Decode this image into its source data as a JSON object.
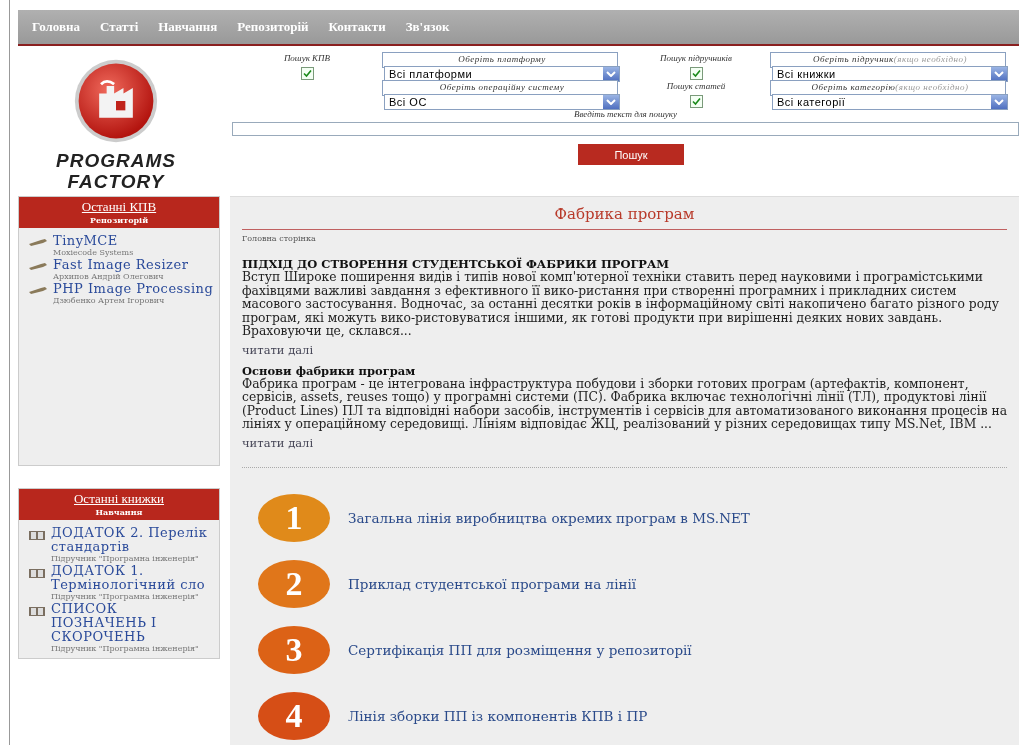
{
  "nav": [
    "Головна",
    "Статті",
    "Навчання",
    "Репозиторій",
    "Контакти",
    "Зв'язок"
  ],
  "logo": {
    "line1": "PROGRAMS",
    "line2": "FACTORY"
  },
  "search": {
    "fields": [
      {
        "kind": "checkbox",
        "label": "Пошук КПВ",
        "checked": true
      },
      {
        "kind": "select",
        "label": "Оберіть платформу",
        "value": "Всі платформи"
      },
      {
        "kind": "checkbox",
        "label": "Пошук підручників",
        "checked": true
      },
      {
        "kind": "select",
        "label": "Оберіть підручник",
        "hint": "(якщо необхідно)",
        "value": "Всі книжки"
      },
      {
        "kind": "blank"
      },
      {
        "kind": "select",
        "label": "Оберіть операційну систему",
        "value": "Всі ОС"
      },
      {
        "kind": "checkbox",
        "label": "Пошук статей",
        "checked": true
      },
      {
        "kind": "select",
        "label": "Оберіть категорію",
        "hint": "(якщо необхідно)",
        "value": "Всі категорії"
      }
    ],
    "text_label": "Введіть текст для пошуку",
    "button": "Пошук"
  },
  "sidebar": [
    {
      "title": "Останні КПВ",
      "subtitle": "Репозиторій",
      "kind": "tool",
      "items": [
        {
          "title": "TinyMCE",
          "author": "Moxiecode Systems"
        },
        {
          "title": "Fast Image Resizer",
          "author": "Архипов Андрій Олегович"
        },
        {
          "title": "PHP Image Processing",
          "author": "Дзюбенко Артем Ігорович"
        }
      ]
    },
    {
      "title": "Останні книжки",
      "subtitle": "Навчання",
      "kind": "book",
      "items": [
        {
          "title": "ДОДАТОК 2. Перелік стандартів",
          "author": "Підручник \"Програмна інженерія\""
        },
        {
          "title": "ДОДАТОК 1. Термінологічний сло",
          "author": "Підручник \"Програмна інженерія\""
        },
        {
          "title": "СПИСОК ПОЗНАЧЕНЬ І СКОРОЧЕНЬ",
          "author": "Підручник \"Програмна інженерія\""
        }
      ]
    }
  ],
  "main": {
    "title": "Фабрика програм",
    "breadcrumb": "Головна сторінка",
    "articles": [
      {
        "heading": "ПІДХІД ДО СТВОРЕННЯ СТУДЕНТСЬКОЇ ФАБРИКИ ПРОГРАМ",
        "text": "Вступ Широке поширення видів і типів нової комп'ютерної техніки ставить перед науковими і програмістськими фахівцями важливі завдання з ефективного її вико-ристання при створенні програмних і прикладних систем масового застосування. Водночас, за останні десятки років в інформаційному світі накопичено багато різного роду програм, які можуть вико-ристовуватися іншими, як готові продукти при вирішенні деяких нових завдань. Враховуючи це, склався...",
        "more": "читати далі"
      },
      {
        "heading": "Основи фабрики програм",
        "text": "Фабрика програм - це інтегрована інфраструктура побудови і зборки готових програм (артефактів, компонент, сервісів, assets, reuses тощо) у програмні системи (ПС). Фабрика включає технологічні лінії (ТЛ), продуктові лінії (Product Lines) ПЛ та відповідні набори засобів, інструментів і сервісів для автоматизованого виконання процесів на лініях у операційному середовищі. Лініям відповідає ЖЦ, реалізований у різних середовищах типу MS.Net, IBM ...",
        "more": "читати далі"
      }
    ],
    "steps": [
      {
        "number": "1",
        "text": "Загальна лінія виробництва окремих програм в MS.NET",
        "color": "#e08a1a"
      },
      {
        "number": "2",
        "text": "Приклад студентської програми на лінії",
        "color": "#e0761a"
      },
      {
        "number": "3",
        "text": "Сертифікація ПП для розміщення у репозиторії",
        "color": "#dc6216"
      },
      {
        "number": "4",
        "text": "Лінія зборки ПП із компонентів КПВ і ПР",
        "color": "#d64e16"
      }
    ]
  }
}
